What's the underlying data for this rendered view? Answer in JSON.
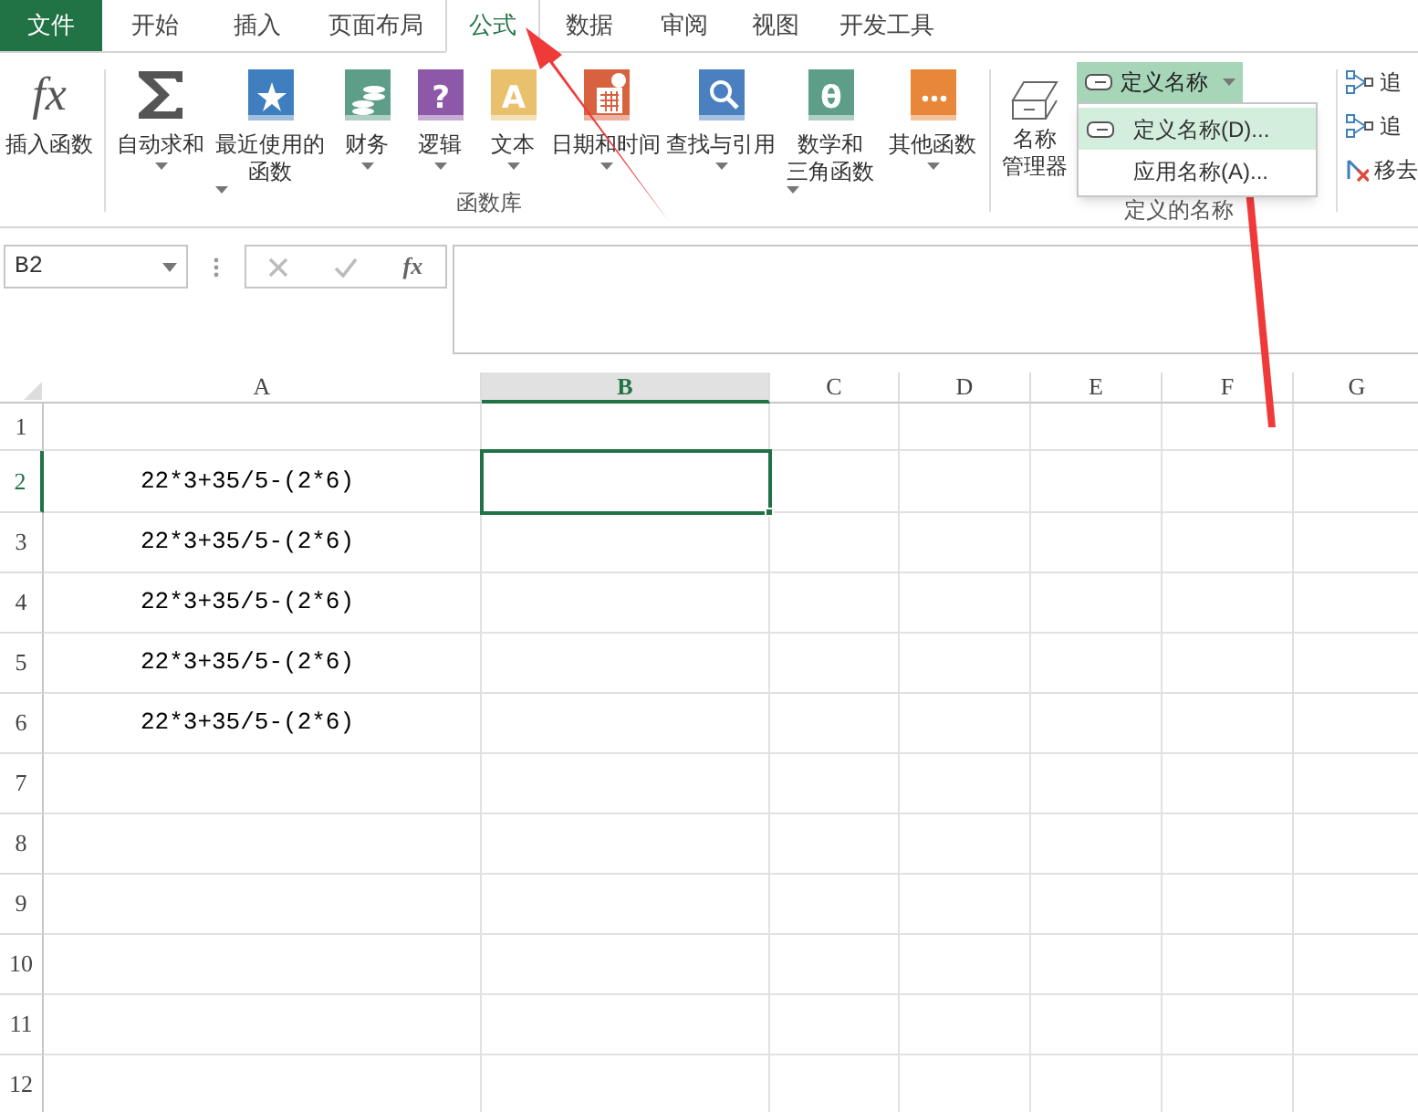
{
  "tabs": [
    {
      "label": "文件",
      "kind": "file",
      "selected": false
    },
    {
      "label": "开始",
      "kind": "tab",
      "selected": false
    },
    {
      "label": "插入",
      "kind": "tab",
      "selected": false
    },
    {
      "label": "页面布局",
      "kind": "tab",
      "selected": false
    },
    {
      "label": "公式",
      "kind": "tab",
      "selected": true
    },
    {
      "label": "数据",
      "kind": "tab",
      "selected": false
    },
    {
      "label": "审阅",
      "kind": "tab",
      "selected": false
    },
    {
      "label": "视图",
      "kind": "tab",
      "selected": false
    },
    {
      "label": "开发工具",
      "kind": "tab",
      "selected": false
    }
  ],
  "ribbon": {
    "function_library": {
      "label": "函数库",
      "buttons": [
        {
          "kind": "fx",
          "glyph": "fx",
          "label": "插入函数",
          "dropdown": false
        },
        {
          "kind": "sigma",
          "label": "自动求和",
          "dropdown": true
        },
        {
          "kind": "book",
          "color": "#3f7ebf",
          "label": "最近使用的",
          "label2": "函数",
          "dropdown": true
        },
        {
          "kind": "book",
          "color": "#5e9e88",
          "label": "财务",
          "dropdown": true
        },
        {
          "kind": "book",
          "glyph": "?",
          "color": "#8d58a8",
          "label": "逻辑",
          "dropdown": true
        },
        {
          "kind": "book",
          "glyph": "A",
          "color": "#e9c16c",
          "label": "文本",
          "dropdown": true
        },
        {
          "kind": "book",
          "color": "#d8623f",
          "label": "日期和时间",
          "dropdown": true
        },
        {
          "kind": "book",
          "color": "#4a7fc0",
          "label": "查找与引用",
          "dropdown": true
        },
        {
          "kind": "book",
          "glyph": "θ",
          "color": "#5e9e88",
          "label": "数学和",
          "label2": "三角函数",
          "dropdown": true
        },
        {
          "kind": "book",
          "color": "#e8873a",
          "label": "其他函数",
          "dropdown": true
        }
      ]
    },
    "defined_names": {
      "label": "定义的名称",
      "manager": {
        "label": "名称",
        "label2": "管理器"
      },
      "define_button": {
        "label": "定义名称",
        "open": true
      },
      "menu": [
        {
          "label": "定义名称(D)...",
          "highlighted": true
        },
        {
          "label": "应用名称(A)...",
          "highlighted": false
        }
      ]
    },
    "auditing": [
      {
        "label": "追"
      },
      {
        "label": "追"
      },
      {
        "label": "移去"
      }
    ]
  },
  "name_box": {
    "value": "B2"
  },
  "formula_bar": {
    "fx": "fx"
  },
  "columns": [
    {
      "label": "A",
      "selected": false
    },
    {
      "label": "B",
      "selected": true
    },
    {
      "label": "C",
      "selected": false
    },
    {
      "label": "D",
      "selected": false
    },
    {
      "label": "E",
      "selected": false
    },
    {
      "label": "F",
      "selected": false
    },
    {
      "label": "G",
      "selected": false
    }
  ],
  "rows": [
    {
      "label": "1",
      "selected": false
    },
    {
      "label": "2",
      "selected": true,
      "a": "22*3+35/5-(2*6)"
    },
    {
      "label": "3",
      "selected": false,
      "a": "22*3+35/5-(2*6)"
    },
    {
      "label": "4",
      "selected": false,
      "a": "22*3+35/5-(2*6)"
    },
    {
      "label": "5",
      "selected": false,
      "a": "22*3+35/5-(2*6)"
    },
    {
      "label": "6",
      "selected": false,
      "a": "22*3+35/5-(2*6)"
    },
    {
      "label": "7",
      "selected": false
    },
    {
      "label": "8",
      "selected": false
    },
    {
      "label": "9",
      "selected": false
    },
    {
      "label": "10",
      "selected": false
    },
    {
      "label": "11",
      "selected": false
    },
    {
      "label": "12",
      "selected": false
    }
  ]
}
